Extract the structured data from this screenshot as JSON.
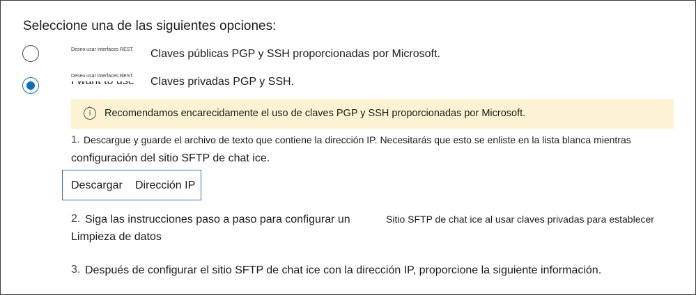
{
  "heading": "Seleccione una de las siguientes opciones:",
  "options": [
    {
      "small_prefix": "Deseo usar interfaces REST.",
      "label": "Claves públicas PGP y SSH proporcionadas por Microsoft.",
      "selected": false
    },
    {
      "small_prefix": "Deseo usar interfaces REST.",
      "label": "Claves privadas PGP y SSH.",
      "ghost_text": "I want to use",
      "selected": true
    }
  ],
  "notice": {
    "icon": "info-icon",
    "text": "Recomendamos encarecidamente el uso de claves PGP y SSH proporcionadas por Microsoft."
  },
  "steps": [
    {
      "number": "1.",
      "line1": "Descargue y guarde el archivo de texto que contiene la dirección IP. Necesitarás que esto se enliste en la lista blanca mientras",
      "line2": "configuración del sitio SFTP de chat ice."
    },
    {
      "number": "2.",
      "line1_part1": "Siga las instrucciones paso a paso para configurar un",
      "line1_part2": "Sitio SFTP de chat ice al usar claves privadas para establecer",
      "line2": "Limpieza de datos"
    },
    {
      "number": "3.",
      "line1": "Después de configurar el sitio SFTP de chat ice con la dirección IP, proporcione la siguiente información."
    }
  ],
  "download_button": {
    "word1": "Descargar",
    "word2": "Dirección IP"
  },
  "colors": {
    "accent": "#0f6cbd",
    "notice_bg": "#fbf3d3",
    "button_border": "#2f6fb5"
  }
}
